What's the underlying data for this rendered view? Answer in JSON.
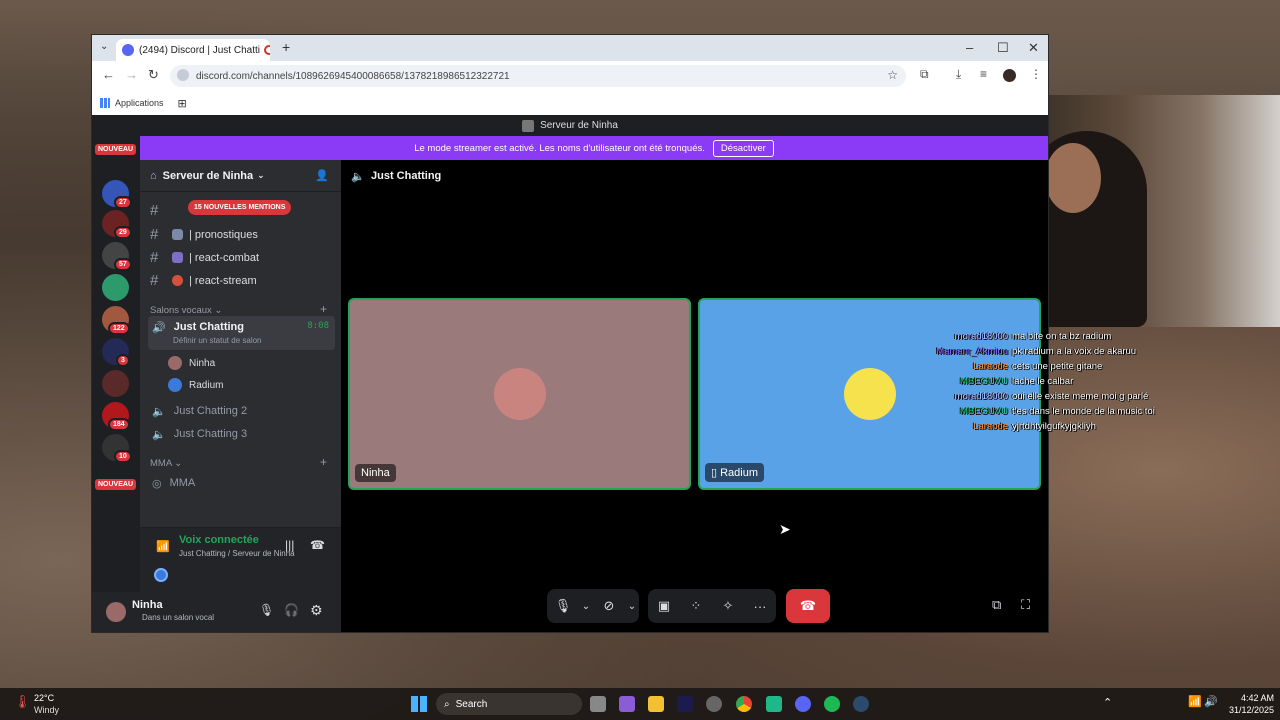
{
  "browser": {
    "tab_title": "(2494) Discord | Just Chatti",
    "url": "discord.com/channels/1089626945400086658/1378218986512322721",
    "bookmark_label": "Applications"
  },
  "discord": {
    "top_title": "Serveur de Ninha",
    "banner_text": "Le mode streamer est activé. Les noms d'utilisateur ont été tronqués.",
    "banner_button": "Désactiver",
    "server_name": "Serveur de Ninha",
    "mentions_badge": "15 NOUVELLES MENTIONS",
    "guilds": {
      "nouveau_top": "NOUVEAU",
      "nouveau_bottom": "NOUVEAU",
      "badges": [
        "27",
        "29",
        "57",
        "122",
        "3",
        "184",
        "10"
      ]
    },
    "text_channels": [
      {
        "name": "| pronostiques"
      },
      {
        "name": "| react-combat"
      },
      {
        "name": "| react-stream"
      }
    ],
    "voice_section_label": "Salons vocaux",
    "voice_channels": {
      "active_name": "Just Chatting",
      "active_timer": "8:08",
      "active_status": "Définir un statut de salon",
      "members": [
        "Ninha",
        "Radium"
      ],
      "other1": "Just Chatting 2",
      "other2": "Just Chatting 3"
    },
    "mma_section_label": "MMA",
    "mma_channel": "MMA",
    "voice_connected": {
      "title": "Voix connectée",
      "subtitle": "Just Chatting / Serveur de Ninha"
    },
    "user": {
      "name": "Ninha",
      "status": "Dans un salon vocal"
    },
    "call_header": "Just Chatting",
    "tiles": [
      {
        "name": "Ninha",
        "bg": "#9a7a7a"
      },
      {
        "name": "Radium",
        "bg": "#5aa2e8"
      }
    ]
  },
  "stream_chat": [
    {
      "user": "morad18000",
      "msg": "ma bite on ta bz radium",
      "color": "#b7b9ff"
    },
    {
      "user": "Mamanr_Akmiuu",
      "msg": "pk radium a la voix de akaruu",
      "color": "#9b59ff"
    },
    {
      "user": "Laraode",
      "msg": "cets une petite gitane",
      "color": "#ff8a2a"
    },
    {
      "user": "MBEGUVU",
      "msg": "lache le calbar",
      "color": "#21c46a"
    },
    {
      "user": "morad18000",
      "msg": "oui elle existe meme moi g parlé",
      "color": "#b7b9ff"
    },
    {
      "user": "MBEGUVU",
      "msg": "t'es dans le monde de la music toi",
      "color": "#21c46a"
    },
    {
      "user": "Laraode",
      "msg": "yjrtdhtyilgufkyjgkliyh",
      "color": "#ff8a2a"
    }
  ],
  "taskbar": {
    "weather_temp": "22°C",
    "weather_desc": "Windy",
    "search_label": "Search",
    "time": "4:42 AM",
    "date": "31/12/2025"
  },
  "icons": {
    "back": "arrow-left-icon",
    "forward": "arrow-right-icon",
    "reload": "reload-icon",
    "mic": "microphone-icon",
    "hangup": "phone-hangup-icon"
  }
}
